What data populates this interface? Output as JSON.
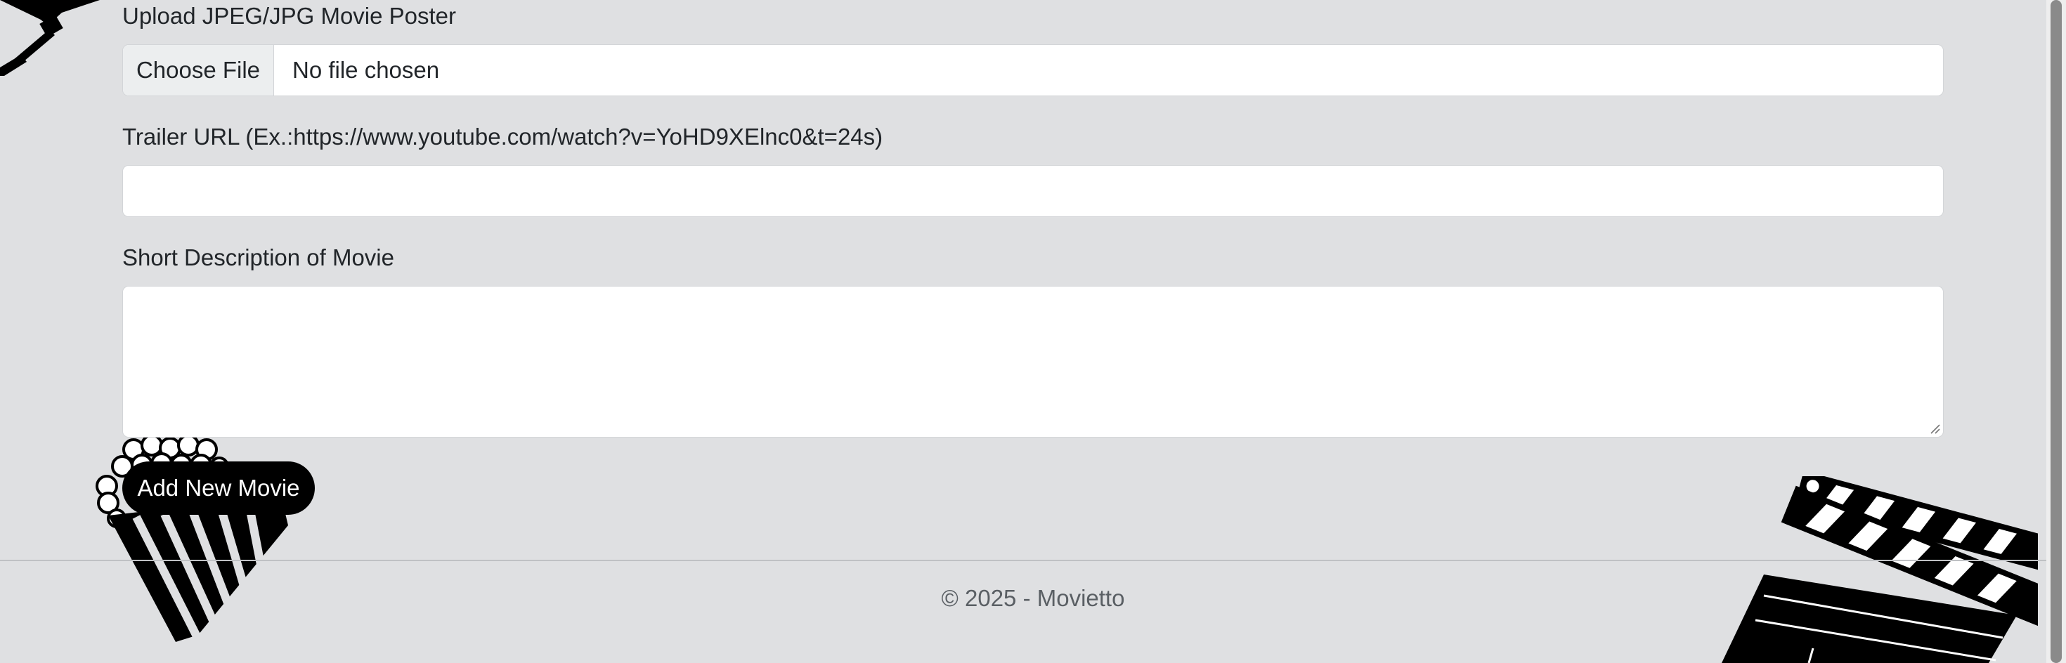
{
  "form": {
    "poster_label": "Upload JPEG/JPG Movie Poster",
    "choose_file_label": "Choose File",
    "file_status": "No file chosen",
    "trailer_label": "Trailer URL (Ex.:https://www.youtube.com/watch?v=YoHD9XElnc0&t=24s)",
    "trailer_value": "",
    "description_label": "Short Description of Movie",
    "description_value": "",
    "submit_label": "Add New Movie"
  },
  "footer": {
    "copyright": "© 2025 - Movietto"
  },
  "icons": {
    "top_left": "movie-camera-icon",
    "popcorn": "popcorn-icon",
    "clapperboard": "clapperboard-icon"
  },
  "colors": {
    "background": "#dfe0e2",
    "button": "#000000",
    "input": "#ffffff"
  }
}
